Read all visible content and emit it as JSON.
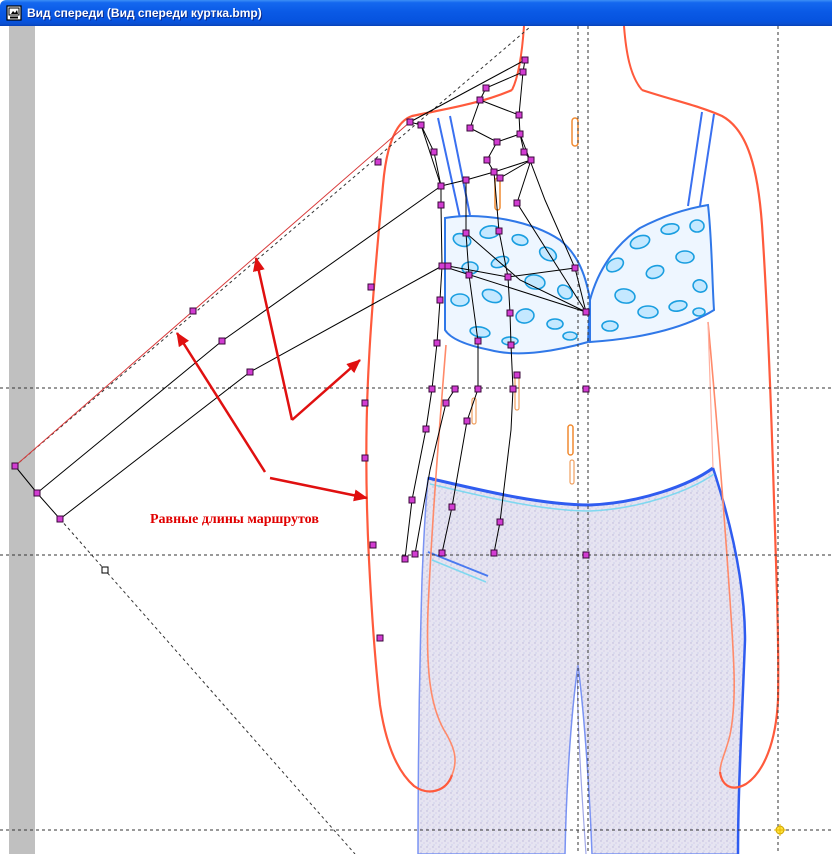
{
  "window": {
    "title": "Вид спереди (Вид спереди куртка.bmp)",
    "icon": "app-window-icon",
    "titlebar_color": "#0a5ae6"
  },
  "canvas": {
    "annotation": "Равные длины маршрутов",
    "annotation_color": "#e00000",
    "node_color": "#d23cd2",
    "node_border_color": "#3a0a3a",
    "route_line_color": "#000000",
    "red_route_color": "#d83a3a",
    "guide_color": "#333333"
  }
}
